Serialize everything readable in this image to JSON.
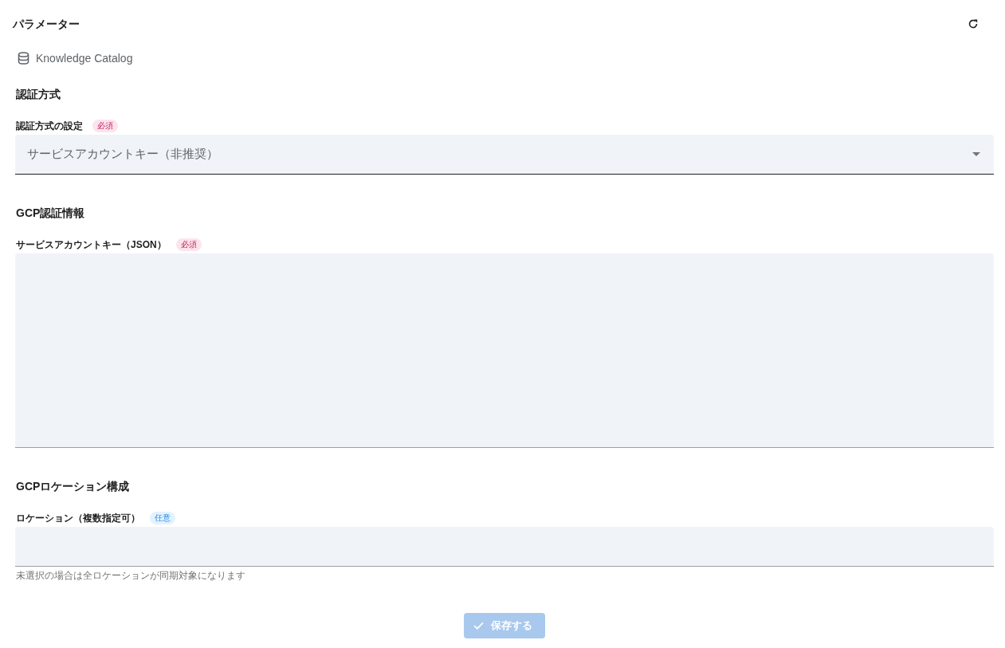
{
  "header": {
    "title": "パラメーター"
  },
  "connector": {
    "name": "Knowledge Catalog"
  },
  "sections": [
    {
      "title": "認証方式",
      "fields": [
        {
          "kind": "select",
          "label": "認証方式の設定",
          "badge": {
            "text": "必須",
            "kind": "required"
          },
          "value": "サービスアカウントキー（非推奨）"
        }
      ]
    },
    {
      "title": "GCP認証情報",
      "fields": [
        {
          "kind": "textarea",
          "label": "サービスアカウントキー（JSON）",
          "badge": {
            "text": "必須",
            "kind": "required"
          }
        }
      ]
    },
    {
      "title": "GCPロケーション構成",
      "fields": [
        {
          "kind": "multiselect",
          "label": "ロケーション（複数指定可）",
          "badge": {
            "text": "任意",
            "kind": "optional"
          },
          "helper": "未選択の場合は全ロケーションが同期対象になります"
        }
      ]
    }
  ],
  "save_button": {
    "label": "保存する",
    "disabled": true
  }
}
